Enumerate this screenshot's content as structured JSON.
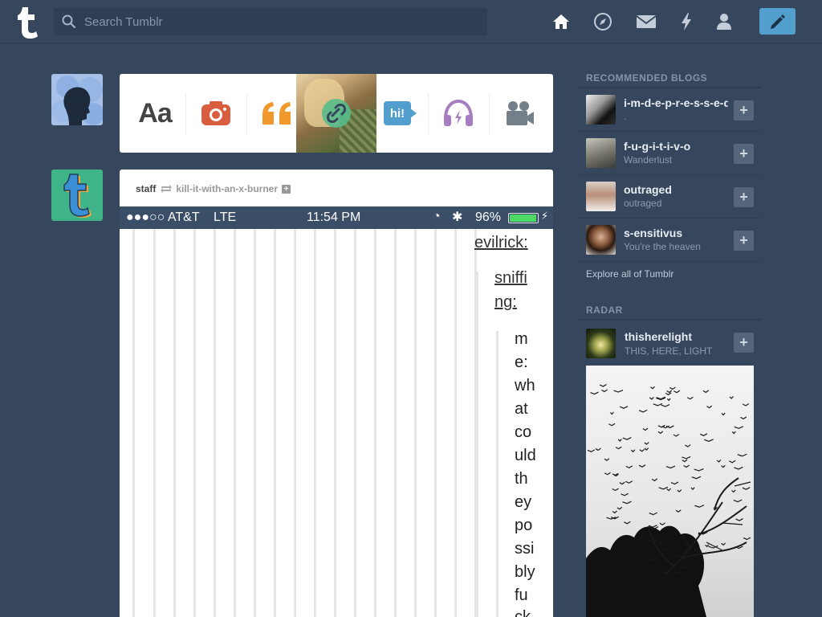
{
  "colors": {
    "background": "#36465d",
    "accent": "#529ecc",
    "post_text": "#444444"
  },
  "header": {
    "logo_icon": "tumblr-logo-icon",
    "search_placeholder": "Search Tumblr",
    "nav_icons": [
      "home-icon",
      "explore-compass-icon",
      "inbox-mail-icon",
      "activity-bolt-icon",
      "account-person-icon"
    ],
    "compose_icon": "pencil-icon"
  },
  "post_types": [
    "text",
    "photo",
    "quote",
    "link",
    "chat",
    "audio",
    "video"
  ],
  "post_type_labels": {
    "text": "Aa",
    "chat": "hi!"
  },
  "post": {
    "author": "staff",
    "reblogged_from": "kill-it-with-an-x-burner",
    "status_bar": {
      "carrier": "●●●○○ AT&T",
      "network": "LTE",
      "time": "11:54 PM",
      "battery": "96%",
      "battery_level": 0.96
    },
    "chat_lines": [
      {
        "text": "evilrick:",
        "kind": "name"
      },
      {
        "text": "sniffi",
        "kind": "name"
      },
      {
        "text": "ng:",
        "kind": "name"
      },
      {
        "text": "m",
        "kind": "text"
      },
      {
        "text": "e:",
        "kind": "text"
      },
      {
        "text": "wh",
        "kind": "text"
      },
      {
        "text": "at",
        "kind": "text"
      },
      {
        "text": "co",
        "kind": "text"
      },
      {
        "text": "uld",
        "kind": "text"
      },
      {
        "text": "th",
        "kind": "text"
      },
      {
        "text": "ey",
        "kind": "text"
      },
      {
        "text": "po",
        "kind": "text"
      },
      {
        "text": "ssi",
        "kind": "text"
      },
      {
        "text": "bly",
        "kind": "text"
      },
      {
        "text": "fu",
        "kind": "text"
      },
      {
        "text": "ck",
        "kind": "text"
      }
    ]
  },
  "sidebar": {
    "recommended_title": "RECOMMENDED BLOGS",
    "blogs": [
      {
        "name": "i-m-d-e-p-r-e-s-s-e-d",
        "sub": "."
      },
      {
        "name": "f-u-g-i-t-i-v-o",
        "sub": "Wanderlust"
      },
      {
        "name": "outraged",
        "sub": "outraged"
      },
      {
        "name": "s-ensitivus",
        "sub": "You're the heaven"
      }
    ],
    "explore_link": "Explore all of Tumblr",
    "radar_title": "RADAR",
    "radar": {
      "name": "thisherelight",
      "sub": "THIS, HERE, LIGHT"
    },
    "follow_label": "+"
  }
}
